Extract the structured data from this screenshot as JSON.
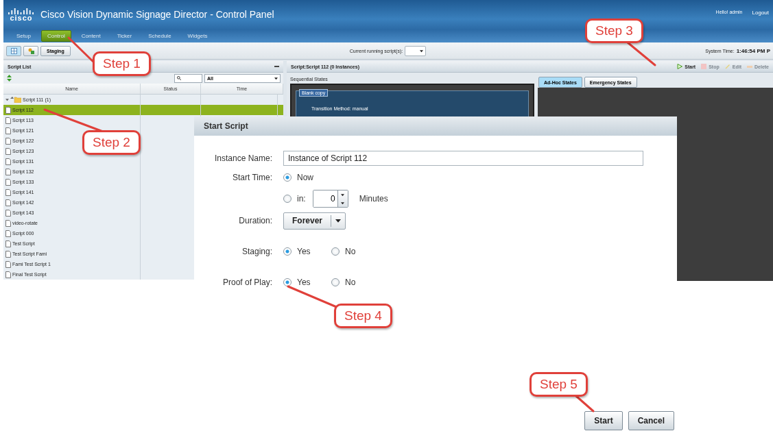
{
  "header": {
    "logo": "cisco",
    "title": "Cisco Vision Dynamic Signage Director - Control Panel",
    "greeting": "Hello! admin",
    "logout": "Logout"
  },
  "nav": [
    {
      "label": "Setup",
      "selected": false
    },
    {
      "label": "Control",
      "selected": true
    },
    {
      "label": "Content",
      "selected": false
    },
    {
      "label": "Ticker",
      "selected": false
    },
    {
      "label": "Schedule",
      "selected": false
    },
    {
      "label": "Widgets",
      "selected": false
    }
  ],
  "toolbar": {
    "views": [
      {
        "kind": "list",
        "selected": true
      },
      {
        "kind": "tree",
        "selected": false
      }
    ],
    "staging": "Staging",
    "running_label": "Current running script(s):",
    "time_label": "System Time:",
    "time": "1:46:54 PM P"
  },
  "script_list": {
    "title": "Script List",
    "filter": "All",
    "columns": [
      "Name",
      "Status",
      "Time"
    ],
    "rows": [
      {
        "kind": "folder",
        "name": "Script 111 (1)",
        "selected": false
      },
      {
        "kind": "file",
        "name": "Script 112",
        "selected": true
      },
      {
        "kind": "file",
        "name": "Script 113",
        "selected": false
      },
      {
        "kind": "file",
        "name": "Script 121",
        "selected": false
      },
      {
        "kind": "file",
        "name": "Script 122",
        "selected": false
      },
      {
        "kind": "file",
        "name": "Script 123",
        "selected": false
      },
      {
        "kind": "file",
        "name": "Script 131",
        "selected": false
      },
      {
        "kind": "file",
        "name": "Script 132",
        "selected": false
      },
      {
        "kind": "file",
        "name": "Script 133",
        "selected": false
      },
      {
        "kind": "file",
        "name": "Script 141",
        "selected": false
      },
      {
        "kind": "file",
        "name": "Script 142",
        "selected": false
      },
      {
        "kind": "file",
        "name": "Script 143",
        "selected": false
      },
      {
        "kind": "file",
        "name": "video-rotate",
        "selected": false
      },
      {
        "kind": "file",
        "name": "Script 000",
        "selected": false
      },
      {
        "kind": "file",
        "name": "Test Script",
        "selected": false
      },
      {
        "kind": "file",
        "name": "Test Script Fami",
        "selected": false
      },
      {
        "kind": "file",
        "name": "Fami Test Script 1",
        "selected": false
      },
      {
        "kind": "file",
        "name": "Final Test Script",
        "selected": false
      }
    ]
  },
  "script_panel": {
    "title": "Script:Script 112 (0 Instances)",
    "actions": [
      {
        "kind": "start",
        "label": "Start",
        "disabled": false
      },
      {
        "kind": "stop",
        "label": "Stop",
        "disabled": true
      },
      {
        "kind": "edit",
        "label": "Edit",
        "disabled": true
      },
      {
        "kind": "delete",
        "label": "Delete",
        "disabled": true
      }
    ],
    "sequential_label": "Sequential States",
    "state": {
      "name": "Blank copy",
      "detail": "Transition Method: manual"
    },
    "tabs": [
      {
        "label": "Ad-Hoc States",
        "selected": true
      },
      {
        "label": "Emergency States",
        "selected": false
      }
    ]
  },
  "dialog": {
    "title": "Start Script",
    "instance_label": "Instance Name:",
    "instance_value": "Instance of Script 112",
    "start_label": "Start Time:",
    "start_options": [
      {
        "label": "Now",
        "selected": true
      },
      {
        "label": "in:",
        "selected": false
      }
    ],
    "minutes_value": "0",
    "minutes_unit": "Minutes",
    "duration_label": "Duration:",
    "duration_value": "Forever",
    "staging_label": "Staging:",
    "staging_options": [
      {
        "label": "Yes",
        "selected": true
      },
      {
        "label": "No",
        "selected": false
      }
    ],
    "proof_label": "Proof of Play:",
    "proof_options": [
      {
        "label": "Yes",
        "selected": true
      },
      {
        "label": "No",
        "selected": false
      }
    ],
    "buttons": [
      "Start",
      "Cancel"
    ]
  },
  "callouts": [
    "Step 1",
    "Step 2",
    "Step 3",
    "Step 4",
    "Step 5"
  ]
}
